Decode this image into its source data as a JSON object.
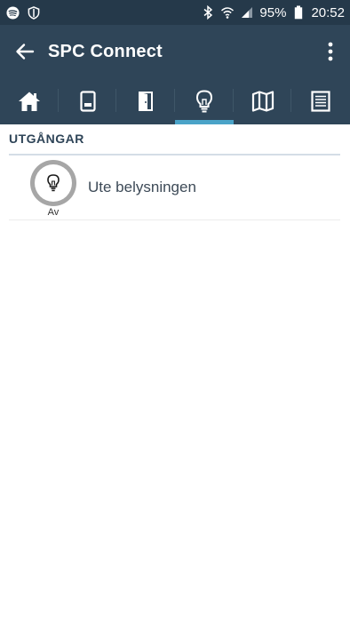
{
  "status_bar": {
    "battery": "95%",
    "time": "20:52",
    "icons": [
      "spotify-icon",
      "shield-icon",
      "bluetooth-icon",
      "wifi-icon",
      "signal-icon",
      "battery-icon"
    ]
  },
  "app_bar": {
    "title": "SPC Connect"
  },
  "tabs": [
    {
      "icon": "home-icon"
    },
    {
      "icon": "keypad-icon"
    },
    {
      "icon": "door-icon"
    },
    {
      "icon": "lightbulb-icon",
      "active": true
    },
    {
      "icon": "map-icon"
    },
    {
      "icon": "list-icon"
    }
  ],
  "section": {
    "title": "UTGÅNGAR"
  },
  "outputs": [
    {
      "name": "Ute belysningen",
      "state": "Av"
    }
  ],
  "colors": {
    "status_bar": "#25394a",
    "app_bar": "#2f4558",
    "tab_indicator": "#4aa3c8",
    "section_title": "#2f4558"
  }
}
